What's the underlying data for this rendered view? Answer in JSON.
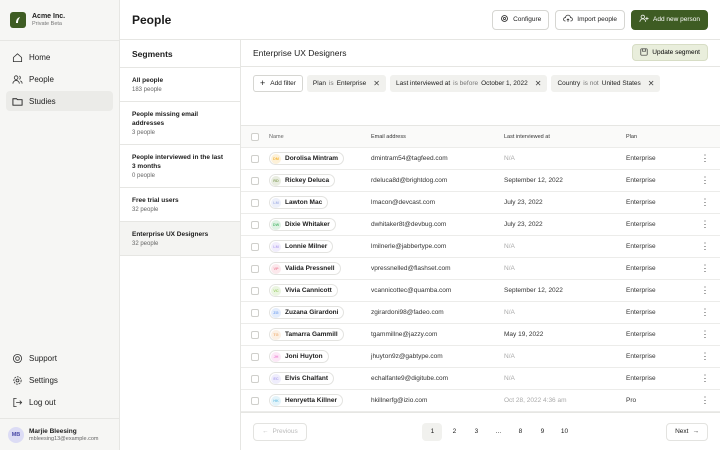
{
  "brand": {
    "name": "Acme Inc.",
    "subtitle": "Private Beta"
  },
  "nav": {
    "items": [
      {
        "label": "Home",
        "icon": "home-icon"
      },
      {
        "label": "People",
        "icon": "people-icon"
      },
      {
        "label": "Studies",
        "icon": "folder-icon",
        "active": true
      }
    ],
    "bottom": [
      {
        "label": "Support",
        "icon": "support-icon"
      },
      {
        "label": "Settings",
        "icon": "gear-icon"
      },
      {
        "label": "Log out",
        "icon": "logout-icon"
      }
    ]
  },
  "user": {
    "initials": "MB",
    "name": "Marjie Bleesing",
    "email": "mbleesing13@example.com"
  },
  "header": {
    "title": "People",
    "configure": "Configure",
    "import": "Import people",
    "add": "Add new person"
  },
  "segments": {
    "title": "Segments",
    "items": [
      {
        "name": "All people",
        "count": "183 people"
      },
      {
        "name": "People missing email addresses",
        "count": "3 people"
      },
      {
        "name": "People interviewed in the last 3 months",
        "count": "0 people"
      },
      {
        "name": "Free trial users",
        "count": "32 people"
      },
      {
        "name": "Enterprise UX Designers",
        "count": "32 people",
        "active": true
      }
    ]
  },
  "detail": {
    "title": "Enterprise UX Designers",
    "update_label": "Update segment",
    "add_filter": "Add filter",
    "filters": [
      {
        "field": "Plan",
        "op": "is",
        "value": "Enterprise"
      },
      {
        "field": "Last interviewed at",
        "op": "is before",
        "value": "October 1, 2022"
      },
      {
        "field": "Country",
        "op": "is not",
        "value": "United States"
      }
    ]
  },
  "table": {
    "headers": {
      "name": "Name",
      "email": "Email address",
      "date": "Last interviewed at",
      "plan": "Plan"
    },
    "rows": [
      {
        "initials": "DM",
        "color": "#f6b73c",
        "name": "Dorolisa Mintram",
        "email": "dmintram54@tagfeed.com",
        "date": "N/A",
        "plan": "Enterprise"
      },
      {
        "initials": "RD",
        "color": "#8fa76b",
        "name": "Rickey Deluca",
        "email": "rdeluca8d@brightdog.com",
        "date": "September 12, 2022",
        "plan": "Enterprise"
      },
      {
        "initials": "LM",
        "color": "#a7b4e6",
        "name": "Lawton Mac",
        "email": "lmacon@devcast.com",
        "date": "July 23, 2022",
        "plan": "Enterprise"
      },
      {
        "initials": "DW",
        "color": "#5fbf7a",
        "name": "Dixie Whitaker",
        "email": "dwhitaker8t@devbug.com",
        "date": "July 23, 2022",
        "plan": "Enterprise"
      },
      {
        "initials": "LM",
        "color": "#b8a6f0",
        "name": "Lonnie Milner",
        "email": "lmilnerle@jabbertype.com",
        "date": "N/A",
        "plan": "Enterprise"
      },
      {
        "initials": "VP",
        "color": "#f08aa0",
        "name": "Valida Pressnell",
        "email": "vpressnelled@flashset.com",
        "date": "N/A",
        "plan": "Enterprise"
      },
      {
        "initials": "VC",
        "color": "#9ccf6b",
        "name": "Vivia Cannicott",
        "email": "vcannicottec@quamba.com",
        "date": "September 12, 2022",
        "plan": "Enterprise"
      },
      {
        "initials": "ZG",
        "color": "#7aa6f0",
        "name": "Zuzana Girardoni",
        "email": "zgirardoni98@fadeo.com",
        "date": "N/A",
        "plan": "Enterprise"
      },
      {
        "initials": "TG",
        "color": "#f0b27a",
        "name": "Tamarra Gammill",
        "email": "tgammillne@jazzy.com",
        "date": "May 19, 2022",
        "plan": "Enterprise"
      },
      {
        "initials": "JH",
        "color": "#f08ad6",
        "name": "Joni Huyton",
        "email": "jhuyton9z@gabtype.com",
        "date": "N/A",
        "plan": "Enterprise"
      },
      {
        "initials": "EC",
        "color": "#b0a6f0",
        "name": "Elvis Chalfant",
        "email": "echalfante9@digitube.com",
        "date": "N/A",
        "plan": "Enterprise"
      },
      {
        "initials": "HK",
        "color": "#7ac6e6",
        "name": "Henryetta Killner",
        "email": "hkillnerfg@izio.com",
        "date": "Oct 28, 2022 4:36 am",
        "plan": "Pro"
      }
    ]
  },
  "pager": {
    "prev": "Previous",
    "next": "Next",
    "pages": [
      "1",
      "2",
      "3",
      "...",
      "8",
      "9",
      "10"
    ],
    "current": "1"
  }
}
